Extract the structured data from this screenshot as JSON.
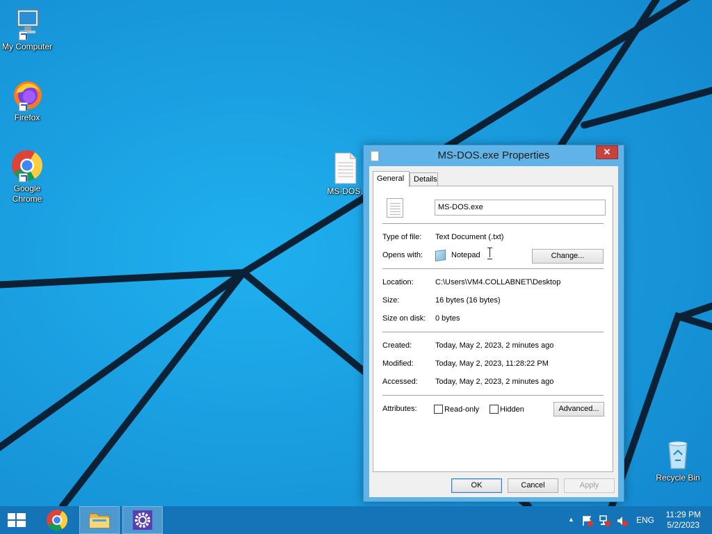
{
  "desktop": {
    "icons": [
      {
        "label": "My Computer"
      },
      {
        "label": "Firefox"
      },
      {
        "label": "Google Chrome"
      },
      {
        "label": "MS-DOS."
      },
      {
        "label": "Recycle Bin"
      }
    ]
  },
  "dialog": {
    "title": "MS-DOS.exe Properties",
    "close_label": "✕",
    "tabs": [
      {
        "label": "General"
      },
      {
        "label": "Details"
      }
    ],
    "file_name": "MS-DOS.exe",
    "type_label": "Type of file:",
    "type_value": "Text Document (.txt)",
    "opens_label": "Opens with:",
    "opens_value": "Notepad",
    "change_label": "Change...",
    "location_label": "Location:",
    "location_value": "C:\\Users\\VM4.COLLABNET\\Desktop",
    "size_label": "Size:",
    "size_value": "16 bytes (16 bytes)",
    "size_disk_label": "Size on disk:",
    "size_disk_value": "0 bytes",
    "created_label": "Created:",
    "created_value": "Today, May 2, 2023, 2 minutes ago",
    "modified_label": "Modified:",
    "modified_value": "Today, May 2, 2023, 11:28:22 PM",
    "accessed_label": "Accessed:",
    "accessed_value": "Today, May 2, 2023, 2 minutes ago",
    "attributes_label": "Attributes:",
    "readonly_label": "Read-only",
    "hidden_label": "Hidden",
    "advanced_label": "Advanced...",
    "ok_label": "OK",
    "cancel_label": "Cancel",
    "apply_label": "Apply"
  },
  "taskbar": {
    "language": "ENG",
    "time": "11:29 PM",
    "date": "5/2/2023",
    "tray_expand": "▲"
  },
  "colors": {
    "wallpaper": "#1a9bdc",
    "taskbar": "#1573b8",
    "dialog_frame": "#5fb3e6",
    "close_button": "#c7423a"
  }
}
